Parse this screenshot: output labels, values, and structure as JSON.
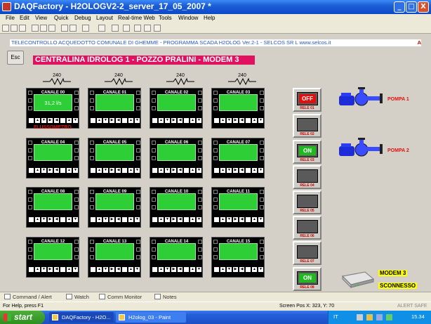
{
  "window": {
    "title": "DAQFactory - H2OLOGV2-2_server_17_05_2007 *",
    "minimize": "_",
    "maximize": "□",
    "close": "X"
  },
  "menu": [
    "File",
    "Edit",
    "View",
    "Quick",
    "Debug",
    "Layout",
    "Real-time Web",
    "Tools",
    "Window",
    "Help"
  ],
  "header": {
    "text": "TELECONTROLLO ACQUEDOTTO COMUNALE DI GHEMME - PROGRAMMA SCADA H2OLOG Ver.2-1 - SELCOS SR L www.selcos.it",
    "flag": "A"
  },
  "esc_button": "Esc",
  "main_title": "CENTRALINA IDROLOG 1 - POZZO PRALINI - MODEM 3",
  "resistors": [
    "240",
    "240",
    "240",
    "240"
  ],
  "channels": [
    {
      "label": "CANALE 00",
      "value": "31,2 l/s"
    },
    {
      "label": "CANALE 01",
      "value": ""
    },
    {
      "label": "CANALE 02",
      "value": ""
    },
    {
      "label": "CANALE 03",
      "value": ""
    },
    {
      "label": "CANALE 04",
      "value": ""
    },
    {
      "label": "CANALE 05",
      "value": ""
    },
    {
      "label": "CANALE 06",
      "value": ""
    },
    {
      "label": "CANALE 07",
      "value": ""
    },
    {
      "label": "CANALE 08",
      "value": ""
    },
    {
      "label": "CANALE 09",
      "value": ""
    },
    {
      "label": "CANALE 10",
      "value": ""
    },
    {
      "label": "CANALE 11",
      "value": ""
    },
    {
      "label": "CANALE 12",
      "value": ""
    },
    {
      "label": "CANALE 13",
      "value": ""
    },
    {
      "label": "CANALE 14",
      "value": ""
    },
    {
      "label": "CANALE 15",
      "value": ""
    }
  ],
  "flow_label": "FLUSSOMETRO",
  "relays": [
    {
      "label": "RELE 01",
      "state": "OFF",
      "color": "#e01010"
    },
    {
      "label": "RELE 02",
      "state": "",
      "color": ""
    },
    {
      "label": "RELE 03",
      "state": "ON",
      "color": "#22b822"
    },
    {
      "label": "RELE 04",
      "state": "",
      "color": ""
    },
    {
      "label": "RELE 05",
      "state": "",
      "color": ""
    },
    {
      "label": "RELE 06",
      "state": "",
      "color": ""
    },
    {
      "label": "RELE 07",
      "state": "",
      "color": ""
    },
    {
      "label": "RELE 08",
      "state": "ON",
      "color": "#22b822"
    }
  ],
  "pumps": [
    "POMPA 1",
    "POMPA 2"
  ],
  "modem": {
    "title": "MODEM 3",
    "status": "SCONNESSO"
  },
  "tabs": [
    "Command / Alert",
    "Watch",
    "Comm Monitor",
    "Notes"
  ],
  "status": {
    "help": "For Help, press F1",
    "screen_pos": "Screen Pos X: 323, Y: 70",
    "alert": "ALERT SAFE"
  },
  "taskbar": {
    "start": "start",
    "tasks": [
      "DAQFactory - H2O...",
      "H2olog_03 - Paint"
    ],
    "lang": "IT",
    "time": "15.34"
  }
}
